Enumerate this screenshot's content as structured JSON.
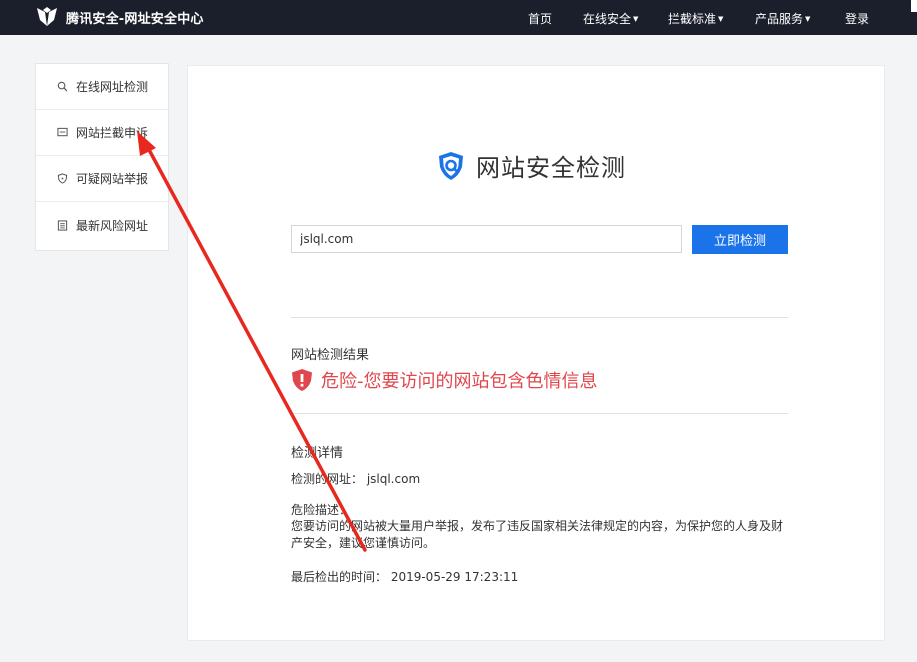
{
  "header": {
    "brand": "腾讯安全-网址安全中心",
    "nav": [
      {
        "label": "首页",
        "has_caret": false
      },
      {
        "label": "在线安全",
        "has_caret": true
      },
      {
        "label": "拦截标准",
        "has_caret": true
      },
      {
        "label": "产品服务",
        "has_caret": true
      },
      {
        "label": "登录",
        "has_caret": false
      }
    ]
  },
  "sidebar": {
    "items": [
      {
        "label": "在线网址检测",
        "icon": "search-icon"
      },
      {
        "label": "网站拦截申诉",
        "icon": "message-icon"
      },
      {
        "label": "可疑网站举报",
        "icon": "shield-icon"
      },
      {
        "label": "最新风险网址",
        "icon": "list-icon"
      }
    ]
  },
  "main": {
    "title": "网站安全检测",
    "search_value": "jslql.com",
    "search_button": "立即检测",
    "result_heading": "网站检测结果",
    "danger_text": "危险-您要访问的网站包含色情信息",
    "detail_heading": "检测详情",
    "detail_url": "检测的网址： jslql.com",
    "risk_label": "危险描述：",
    "risk_desc": "您要访问的网站被大量用户举报，发布了违反国家相关法律规定的内容，为保护您的人身及财产安全，建议您谨慎访问。",
    "checked_time": "最后检出的时间： 2019-05-29 17:23:11"
  },
  "colors": {
    "topbar": "#1b1f2b",
    "accent": "#1a73e8",
    "danger": "#e0474c",
    "annotation_arrow": "#e8281f"
  }
}
